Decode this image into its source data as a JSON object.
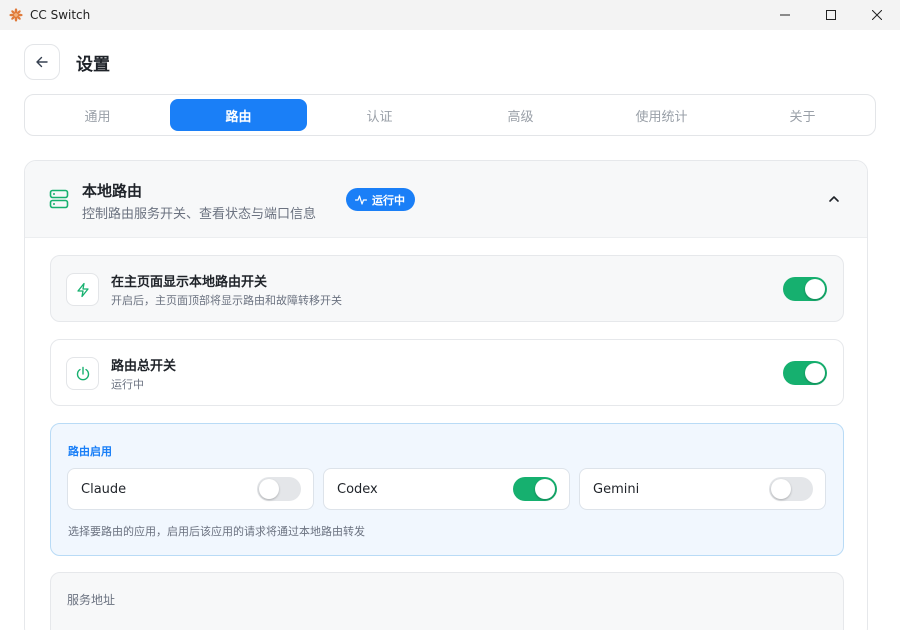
{
  "window": {
    "title": "CC Switch"
  },
  "header": {
    "title": "设置"
  },
  "tabs": [
    {
      "label": "通用",
      "active": false
    },
    {
      "label": "路由",
      "active": true
    },
    {
      "label": "认证",
      "active": false
    },
    {
      "label": "高级",
      "active": false
    },
    {
      "label": "使用统计",
      "active": false
    },
    {
      "label": "关于",
      "active": false
    }
  ],
  "section": {
    "title": "本地路由",
    "subtitle": "控制路由服务开关、查看状态与端口信息",
    "status": "运行中",
    "rows": [
      {
        "title": "在主页面显示本地路由开关",
        "subtitle": "开启后，主页面顶部将显示路由和故障转移开关",
        "enabled": true,
        "icon": "lightning-icon"
      },
      {
        "title": "路由总开关",
        "subtitle": "运行中",
        "enabled": true,
        "icon": "power-icon"
      }
    ],
    "routing": {
      "title": "路由启用",
      "apps": [
        {
          "name": "Claude",
          "enabled": false
        },
        {
          "name": "Codex",
          "enabled": true
        },
        {
          "name": "Gemini",
          "enabled": false
        }
      ],
      "hint": "选择要路由的应用，启用后该应用的请求将通过本地路由转发"
    },
    "service": {
      "title": "服务地址"
    }
  },
  "colors": {
    "accent": "#1a7ff7",
    "toggle_on": "#16b06f",
    "success_icon": "#16b06f"
  }
}
